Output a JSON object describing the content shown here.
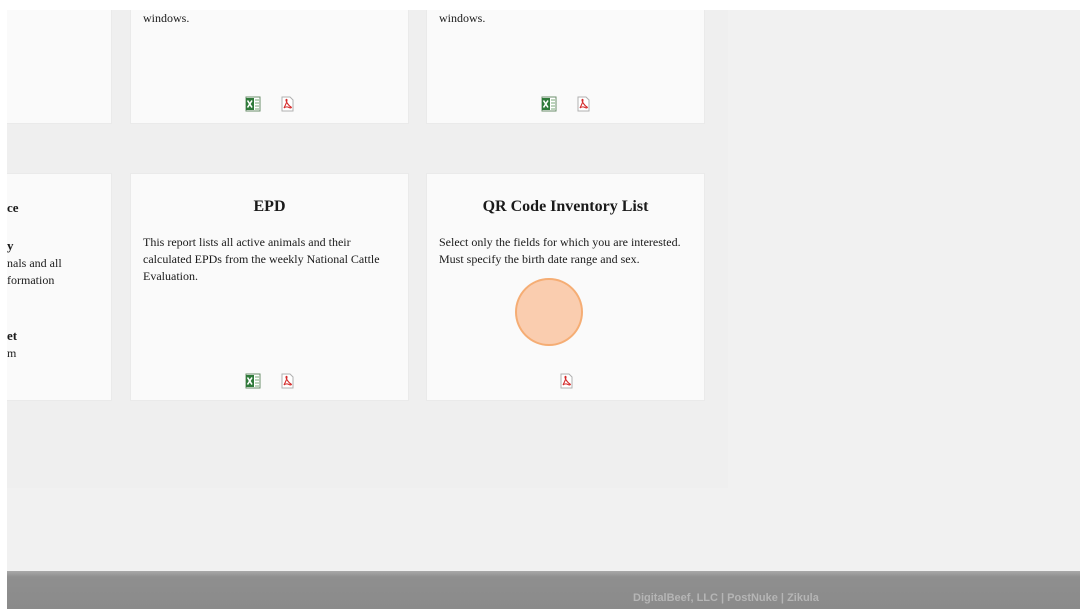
{
  "top_row": {
    "middle_card": {
      "text": "windows."
    },
    "right_card": {
      "text": "windows."
    }
  },
  "bottom_row": {
    "left_partial": {
      "title_fragment": "ce",
      "line1": "y",
      "line2": "nals and all",
      "line3": "formation",
      "line4": "et",
      "line5": "m"
    },
    "epd_card": {
      "title": "EPD",
      "description": "This report lists all active animals and their calculated EPDs from the weekly National Cattle Evaluation."
    },
    "qr_card": {
      "title": "QR Code Inventory List",
      "description": "Select only the fields for which you are interested. Must specify the birth date range and sex."
    }
  },
  "icons": {
    "excel": "excel-icon",
    "pdf": "pdf-icon"
  },
  "footer": {
    "text": "DigitalBeef, LLC | PostNuke | Zikula"
  },
  "colors": {
    "page_bg": "#f1f1f1",
    "card_bg": "#fafafa",
    "footer_bg": "#8f8f8f",
    "footer_text": "#b5b5b5",
    "cursor_highlight": "#f5aa6e"
  }
}
